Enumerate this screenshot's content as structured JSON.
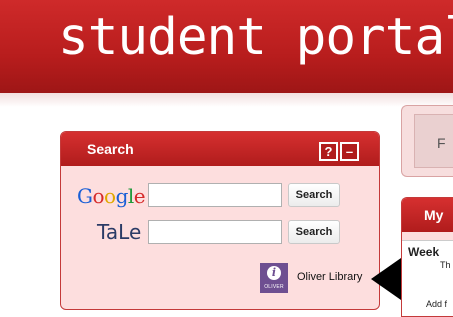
{
  "banner": {
    "title": "student portal"
  },
  "right_strip": {
    "label": "F"
  },
  "search_panel": {
    "title": "Search",
    "help_label": "?",
    "minimize_label": "–",
    "google": {
      "logo_letters": [
        "G",
        "o",
        "o",
        "g",
        "l",
        "e"
      ],
      "input_value": "",
      "button_label": "Search"
    },
    "tale": {
      "logo": "TaLe",
      "input_value": "",
      "button_label": "Search"
    },
    "oliver": {
      "icon_letter": "i",
      "icon_caption": "OLIVER",
      "link_label": "Oliver Library"
    }
  },
  "my_panel": {
    "title": "My",
    "week_label": "Week",
    "row_fragment": "Th",
    "add_label": "Add f"
  },
  "colors": {
    "brand_red": "#b81d1d",
    "panel_bg": "#fddede",
    "oliver_purple": "#6e4f91"
  }
}
